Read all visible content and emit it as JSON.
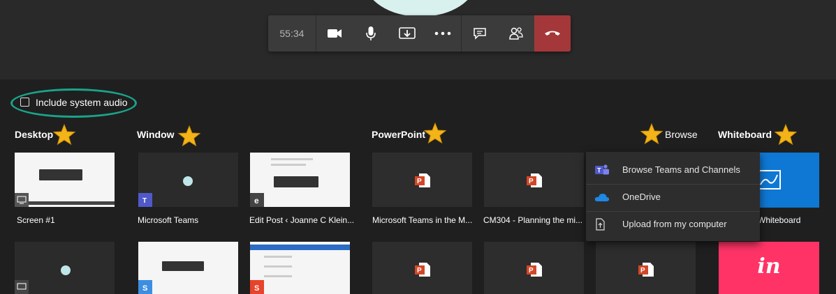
{
  "call_bar": {
    "timer": "55:34",
    "buttons": [
      "camera-icon",
      "microphone-icon",
      "share-tray-icon",
      "more-icon",
      "chat-icon",
      "participants-icon",
      "hang-up-icon"
    ]
  },
  "share": {
    "include_audio_label": "Include system audio",
    "sections": {
      "desktop": "Desktop",
      "window": "Window",
      "powerpoint": "PowerPoint",
      "browse": "Browse",
      "whiteboard": "Whiteboard"
    },
    "row1": {
      "desktop": "Screen #1",
      "window1": "Microsoft Teams",
      "window2": "Edit Post ‹ Joanne C Klein...",
      "ppt1": "Microsoft Teams in the M...",
      "ppt2": "CM304 - Planning the mi...",
      "whiteboard": "Whiteboard"
    },
    "row2": {
      "whiteboard2_logo": "in"
    }
  },
  "browse_menu": {
    "items": [
      "Browse Teams and Channels",
      "OneDrive",
      "Upload from my computer"
    ]
  },
  "colors": {
    "hangup": "#a4373a",
    "highlight_oval": "#1aa38a",
    "star": "#f2b418",
    "whiteboard": "#0f78d4",
    "invision": "#ff3366",
    "powerpoint": "#d24726"
  }
}
